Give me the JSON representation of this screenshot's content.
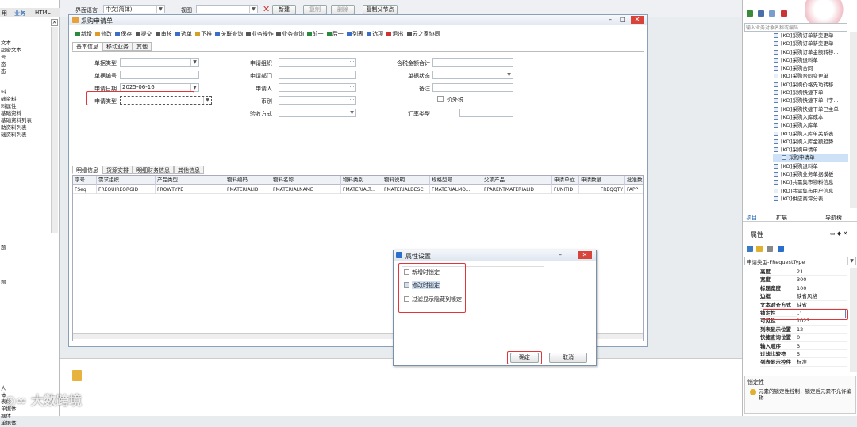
{
  "left": {
    "tabs": [
      "用",
      "业务",
      "HTML"
    ],
    "items": [
      "文本",
      "超密文本",
      "号",
      "态",
      "态",
      "",
      "",
      "料",
      "础资料",
      "料属性",
      "基础资料",
      "基础资料列表",
      "助资料列表",
      "础资料列表",
      "",
      "",
      "",
      "",
      "",
      "",
      "",
      "",
      "",
      "",
      "",
      "",
      "",
      "",
      "",
      "题",
      "",
      "",
      "",
      "",
      "题",
      "",
      "",
      "",
      "",
      "",
      "",
      "",
      "",
      "",
      "",
      "",
      "",
      "",
      "",
      "人",
      "体",
      "表体",
      "单据体",
      "据体",
      "单据体"
    ]
  },
  "toolbar": {
    "lang_label": "界面语言",
    "lang_value": "中文(简体)",
    "view_label": "视图",
    "new_btn": "新建",
    "copy_btn": "复制",
    "del_btn": "删除",
    "copychild_btn": "复制父节点"
  },
  "form": {
    "title": "采购申请单",
    "tools": [
      "新增",
      "修改",
      "保存",
      "提交",
      "审核",
      "选单",
      "下推",
      "关联查询",
      "业务操作",
      "业务查询",
      "前一",
      "后一",
      "列表",
      "选项",
      "退出",
      "云之家协同"
    ],
    "tabs": [
      "基本信息",
      "移动业务",
      "其他"
    ],
    "left_fields": [
      {
        "label": "单据类型"
      },
      {
        "label": "单据编号"
      },
      {
        "label": "申请日期",
        "value": "2025-06-16"
      },
      {
        "label": "申请类型"
      }
    ],
    "mid_fields": [
      "申请组织",
      "申请部门",
      "申请人",
      "币别",
      "验收方式"
    ],
    "right_fields": [
      "含税金额合计",
      "单据状态",
      "备注",
      "",
      "汇率类型"
    ],
    "price_tax": "价外税",
    "detail_tabs": [
      "明细信息",
      "货源安排",
      "明细财务信息",
      "其他信息"
    ],
    "columns": [
      "序号",
      "需求组织",
      "产品类型",
      "物料编码",
      "物料名称",
      "物料类别",
      "物料说明",
      "规格型号",
      "父项产品",
      "申请单位",
      "申请数量",
      "批准数"
    ],
    "row": [
      "FSeq",
      "FREQUIREORGID",
      "FROWTYPE",
      "FMATERIALID",
      "FMATERIALNAME",
      "FMATERIALT...",
      "FMATERIALDESC",
      "FMATERIALMO...",
      "FPARENTMATERIALID",
      "FUNITID",
      "FREQQTY",
      "FAPP"
    ]
  },
  "dialog": {
    "title": "属性设置",
    "options": [
      "新增时锁定",
      "修改时锁定",
      "过滤显示隐藏列锁定"
    ],
    "ok": "确定",
    "cancel": "取消"
  },
  "right_panel": {
    "search_placeholder": "输入业务对象名称或编码",
    "items": [
      "[KD]采购订单新变更单",
      "[KD]采购订单新变更单",
      "[KD]采购订单金额转移...",
      "[KD]采购退料单",
      "[KD]采购合同",
      "[KD]采购合同变更单",
      "[KD]采购价格先功转移...",
      "[KD]采购快捷下单",
      "[KD]采购快捷下单（字...",
      "[KD]采购快捷下单已主单",
      "[KD]采购入库成本",
      "[KD]采购入库单",
      "[KD]采购入库单关系表",
      "[KD]采购入库金额趋势...",
      "[KD]采购申请单",
      "采购申请单",
      "[KD]采购退料单",
      "[KD]采购业务单据模板",
      "[KD]共需集市物料信息",
      "[KD]共需集市用户信息",
      "[KD]供应商评分表"
    ],
    "tabs": [
      "项目",
      "扩展...",
      "导航树",
      "数据源"
    ]
  },
  "properties": {
    "title": "属性",
    "field": "申请类型-FRequestType",
    "rows": [
      {
        "k": "高度",
        "v": "21"
      },
      {
        "k": "宽度",
        "v": "300"
      },
      {
        "k": "标题宽度",
        "v": "100"
      },
      {
        "k": "边框",
        "v": "缺省风格"
      },
      {
        "k": "文本对齐方式",
        "v": "缺省"
      },
      {
        "k": "锁定性",
        "v": "-1"
      },
      {
        "k": "可见性",
        "v": "1023"
      },
      {
        "k": "列表显示位置",
        "v": "12"
      },
      {
        "k": "快捷查询位置",
        "v": "0"
      },
      {
        "k": "输入顺序",
        "v": "3"
      },
      {
        "k": "过滤比较符",
        "v": "5"
      },
      {
        "k": "列表显示控件",
        "v": "标准"
      }
    ],
    "desc_title": "锁定性",
    "desc": "元素的锁定性控制，锁定后元素不允许编辑"
  },
  "watermark": "大数跨境"
}
